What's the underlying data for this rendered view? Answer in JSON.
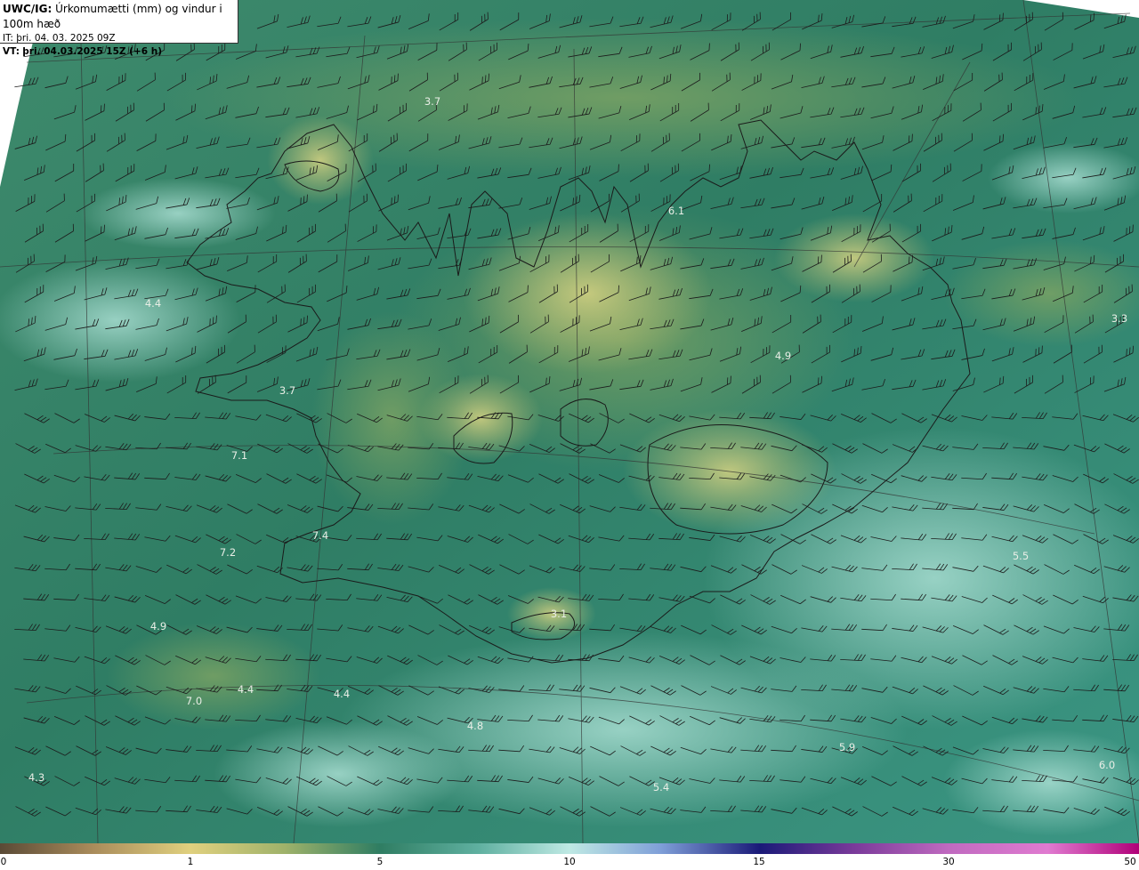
{
  "header": {
    "product_code": "UWC/IG:",
    "product_desc": "Úrkomumætti (mm) og vindur i 100m hæð",
    "it_label": "IT:",
    "it_value": "þri. 04. 03. 2025 09Z",
    "vt_label": "VT:",
    "vt_value": "þri. 04.03.2025 15Z (+6 h)"
  },
  "map": {
    "value_labels": [
      "3.7",
      "6.1",
      "4.4",
      "3.7",
      "4.9",
      "3.3",
      "7.1",
      "7.4",
      "7.2",
      "3.1",
      "5.5",
      "4.9",
      "4.4",
      "7.0",
      "4.4",
      "4.8",
      "5.9",
      "4.3",
      "5.4",
      "6.0"
    ],
    "colors": {
      "sea_base": "#2a7a62",
      "light_band": "#8ecfc2",
      "land_yellow": "#c9c77a",
      "coast": "#1a1a1a",
      "grid": "#333333",
      "barb": "#1c1c1c"
    }
  },
  "colorbar": {
    "ticks": [
      "0",
      "1",
      "5",
      "10",
      "15",
      "30",
      "50"
    ]
  }
}
